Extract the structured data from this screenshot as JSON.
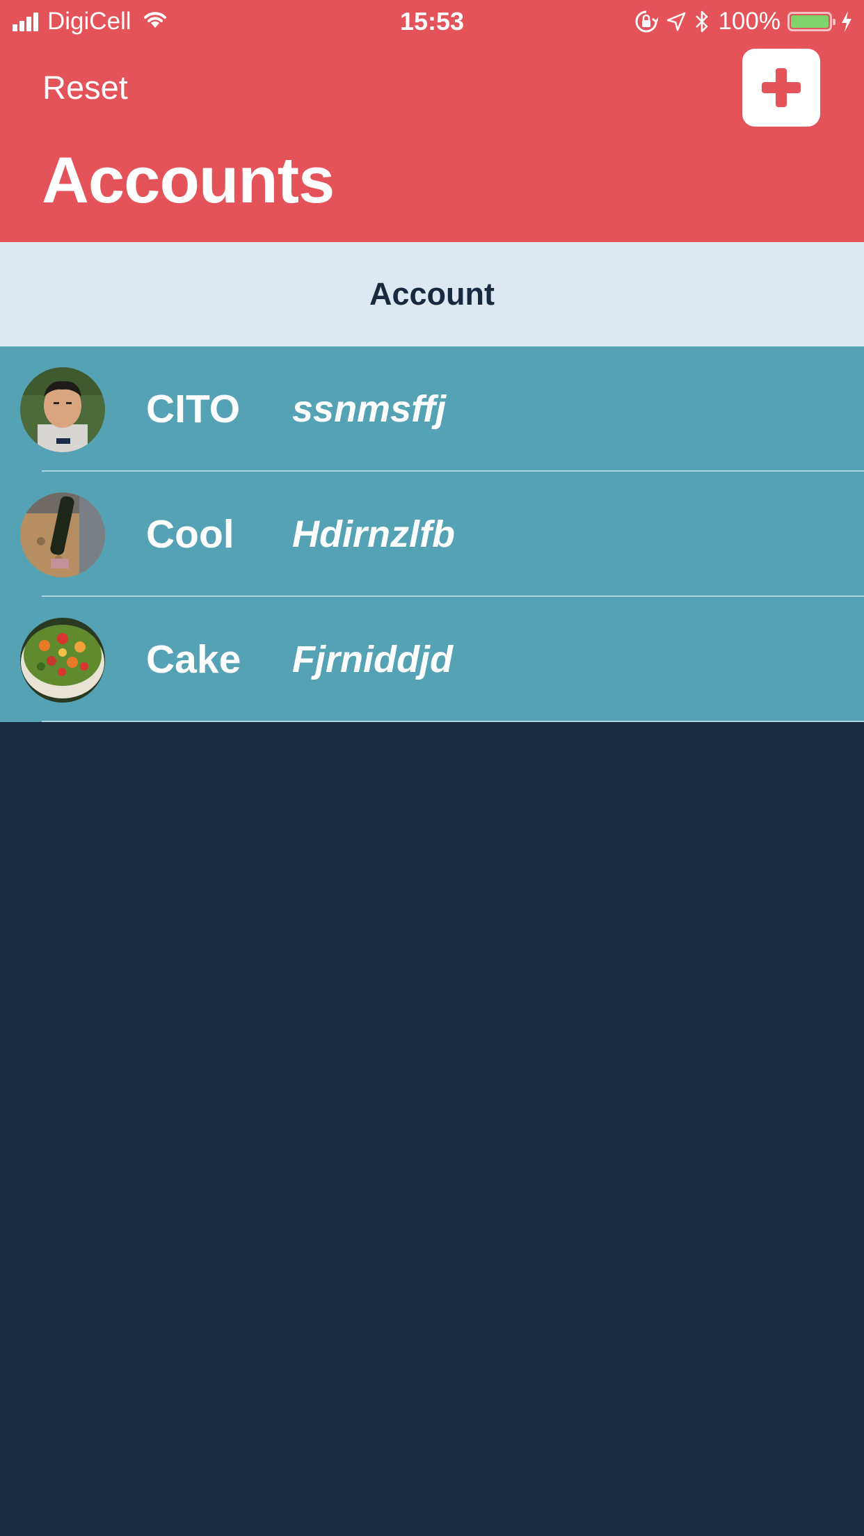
{
  "status_bar": {
    "carrier": "DigiCell",
    "time": "15:53",
    "battery_percent": "100%",
    "icons": [
      "signal-icon",
      "wifi-icon",
      "orientation-lock-icon",
      "location-icon",
      "bluetooth-icon",
      "battery-icon",
      "charging-icon"
    ]
  },
  "nav": {
    "left_button": "Reset",
    "right_button_icon": "plus-icon",
    "title": "Accounts"
  },
  "section": {
    "header": "Account"
  },
  "accounts": [
    {
      "name": "CITO",
      "handle": "ssnmsffj",
      "avatar": "person-photo"
    },
    {
      "name": "Cool",
      "handle": "Hdirnzlfb",
      "avatar": "bottle-photo"
    },
    {
      "name": "Cake",
      "handle": "Fjrniddjd",
      "avatar": "fruit-cake-photo"
    }
  ],
  "colors": {
    "header_bg": "#e5535a",
    "section_bg": "#dde8f1",
    "row_bg": "#56a2b5",
    "page_bg": "#172a40"
  }
}
